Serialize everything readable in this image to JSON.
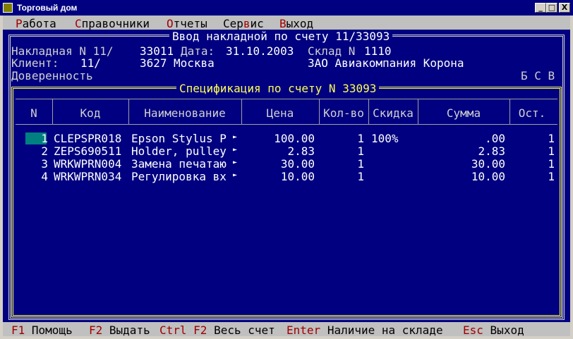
{
  "window": {
    "title": "Торговый дом",
    "min": "_",
    "max": "□",
    "close": "X"
  },
  "menu": [
    {
      "hot": "Р",
      "rest": "абота"
    },
    {
      "hot": "С",
      "rest": "правочники"
    },
    {
      "hot": "О",
      "rest": "тчеты"
    },
    {
      "pre": "Сер",
      "hot": "в",
      "rest": "ис"
    },
    {
      "hot": "В",
      "rest": "ыход"
    }
  ],
  "form": {
    "title": "Ввод накладной по счету 11/33093",
    "invoice_label": "Накладная N 11/",
    "invoice_no": "33011",
    "date_label": "Дата:",
    "date": "31.10.2003",
    "warehouse_label": "Склад N",
    "warehouse": "1110",
    "client_label": "Клиент:",
    "client_prefix": "11/",
    "client_code": "3627",
    "client_city": "Москва",
    "client_name": "ЗАО Авиакомпания Корона",
    "proxy_label": "Доверенность",
    "flags": "Б С В"
  },
  "spec": {
    "title": "Спецификация по счету N 33093",
    "columns": [
      "N",
      "Код",
      "Наименование",
      "Цена",
      "Кол-во",
      "Скидка",
      "Сумма",
      "Ост."
    ],
    "rows": [
      {
        "n": "1",
        "code": "CLEPSPR018",
        "name": "Epson Stylus P",
        "price": "100.00",
        "qty": "1",
        "disc": "100%",
        "sum": ".00",
        "rest": "1"
      },
      {
        "n": "2",
        "code": "ZEPS690511",
        "name": "Holder, pulley",
        "price": "2.83",
        "qty": "1",
        "disc": "",
        "sum": "2.83",
        "rest": "1"
      },
      {
        "n": "3",
        "code": "WRKWPRN004",
        "name": "Замена печатаю",
        "price": "30.00",
        "qty": "1",
        "disc": "",
        "sum": "30.00",
        "rest": "1"
      },
      {
        "n": "4",
        "code": "WRKWPRN034",
        "name": "Регулировка вх",
        "price": "10.00",
        "qty": "1",
        "disc": "",
        "sum": "10.00",
        "rest": "1"
      }
    ],
    "more_marker": "►"
  },
  "status": [
    {
      "key": "F1",
      "label": "Помощь"
    },
    {
      "key": "F2",
      "label": "Выдать"
    },
    {
      "key": "Ctrl F2",
      "label": "Весь счет"
    },
    {
      "key": "Enter",
      "label": "Наличие на складе"
    },
    {
      "key": "Esc",
      "label": "Выход"
    }
  ],
  "colors": {
    "background": "#000080",
    "bars": "#c0c0c0",
    "hotkey": "#a00000",
    "accent": "#ffff55",
    "cursor": "#008080"
  }
}
